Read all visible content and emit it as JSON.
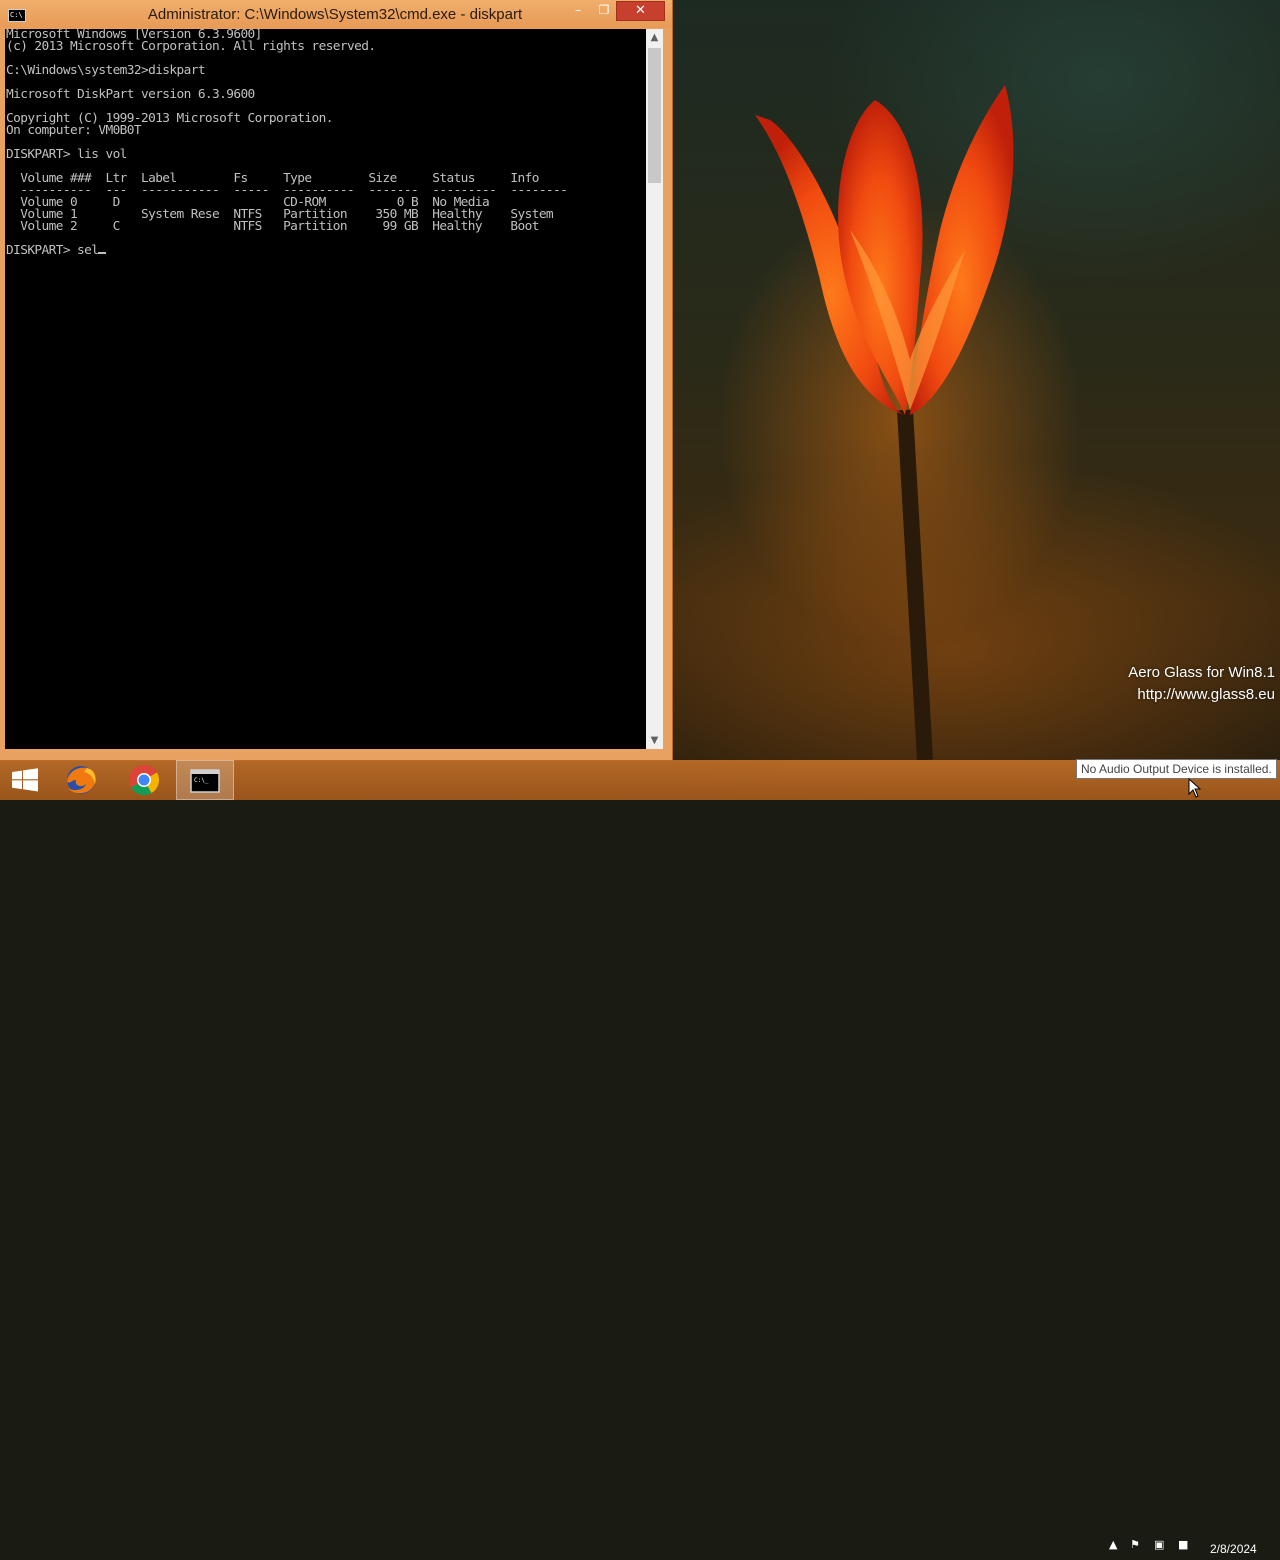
{
  "window": {
    "title": "Administrator: C:\\Windows\\System32\\cmd.exe - diskpart",
    "icon_label": "C:\\",
    "minimize_label": "–",
    "maximize_label": "❐",
    "close_label": "✕"
  },
  "console": {
    "lines": [
      "Microsoft Windows [Version 6.3.9600]",
      "(c) 2013 Microsoft Corporation. All rights reserved.",
      "",
      "C:\\Windows\\system32>diskpart",
      "",
      "Microsoft DiskPart version 6.3.9600",
      "",
      "Copyright (C) 1999-2013 Microsoft Corporation.",
      "On computer: VM0B0T",
      "",
      "DISKPART> lis vol",
      "",
      "  Volume ###  Ltr  Label        Fs     Type        Size     Status     Info",
      "  ----------  ---  -----------  -----  ----------  -------  ---------  --------",
      "  Volume 0     D                       CD-ROM          0 B  No Media",
      "  Volume 1         System Rese  NTFS   Partition    350 MB  Healthy    System",
      "  Volume 2     C                NTFS   Partition     99 GB  Healthy    Boot",
      ""
    ],
    "prompt_line": "DISKPART> sel"
  },
  "desktop": {
    "watermark_line1": "Aero Glass for Win8.1",
    "watermark_line2": "http://www.glass8.eu"
  },
  "taskbar": {
    "tooltip": "No Audio Output Device is installed.",
    "date": "2/8/2024",
    "items": [
      "start-icon",
      "firefox-icon",
      "chrome-icon",
      "cmd-icon"
    ]
  },
  "colors": {
    "console_text": "#c0c0c0",
    "console_bg": "#000000",
    "titlebar": "#e8a160",
    "close_button": "#c7402e"
  }
}
